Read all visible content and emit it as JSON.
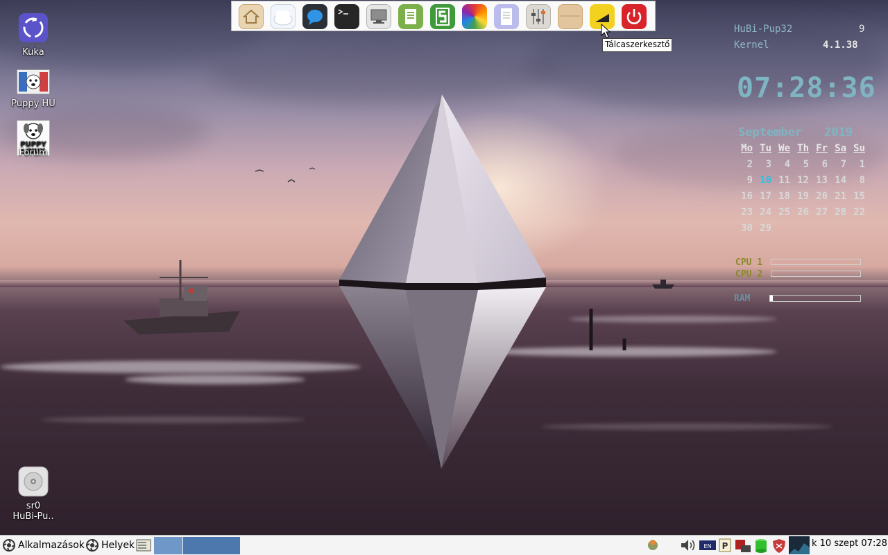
{
  "desktop": {
    "icons": [
      {
        "label": "Kuka",
        "icon": "recycle-bin-icon"
      },
      {
        "label": "Puppy HU",
        "icon": "puppy-hu-icon"
      },
      {
        "label": "Puppy Linux Fórum",
        "line1": "",
        "line2": "Fórum",
        "icon": "puppy-forum-icon",
        "logo_text": "PUPPY LINUX"
      },
      {
        "label_line1": "sr0",
        "label_line2": "HuBi-Pu..",
        "icon": "cd-drive-icon"
      }
    ]
  },
  "dock": {
    "items": [
      {
        "name": "home-folder-icon",
        "color": "#d8b98a"
      },
      {
        "name": "cloud-icon",
        "color": "#e8eef6"
      },
      {
        "name": "chat-icon",
        "color": "#2f8fe0"
      },
      {
        "name": "terminal-icon",
        "color": "#2a2a2a"
      },
      {
        "name": "monitor-icon",
        "color": "#cfcfcf"
      },
      {
        "name": "document-icon",
        "color": "#7fb24a"
      },
      {
        "name": "spreadsheet-icon",
        "color": "#3f9a3a"
      },
      {
        "name": "color-wheel-icon",
        "color": "#e04a7a"
      },
      {
        "name": "text-editor-icon",
        "color": "#b8b8e8"
      },
      {
        "name": "mixer-icon",
        "color": "#d6d2cc"
      },
      {
        "name": "package-icon",
        "color": "#ddbf95"
      },
      {
        "name": "taskbar-editor-icon",
        "color": "#f0d020"
      },
      {
        "name": "power-icon",
        "color": "#d8232a"
      }
    ],
    "tooltip": "Tálcaszerkesztő"
  },
  "conky": {
    "host_label": "HuBi-Pup32",
    "host_value": "9",
    "kernel_label": "Kernel",
    "kernel_value": "4.1.38",
    "clock": "07:28:36",
    "calendar": {
      "month": "September",
      "year": "2019",
      "weekdays": [
        "Mo",
        "Tu",
        "We",
        "Th",
        "Fr",
        "Sa",
        "Su"
      ],
      "rows": [
        [
          "2",
          "3",
          "4",
          "5",
          "6",
          "7",
          "1"
        ],
        [
          "9",
          "10",
          "11",
          "12",
          "13",
          "14",
          "8"
        ],
        [
          "16",
          "17",
          "18",
          "19",
          "20",
          "21",
          "15"
        ],
        [
          "23",
          "24",
          "25",
          "26",
          "27",
          "28",
          "22"
        ],
        [
          "30",
          "29",
          "",
          "",
          "",
          "",
          ""
        ]
      ],
      "today": "10"
    },
    "cpu1_label": "CPU 1",
    "cpu2_label": "CPU 2",
    "ram_label": "RAM",
    "cpu1_level": 0.0,
    "cpu2_level": 0.0,
    "ram_level": 0.03,
    "label_color_cpu": "#8a8a28",
    "label_color_ram": "#6a8ea0"
  },
  "taskbar": {
    "apps_label": "Alkalmazások",
    "places_label": "Helyek",
    "clock": "k 10 szept 07:28",
    "workspace_color": "#4d78ad"
  }
}
